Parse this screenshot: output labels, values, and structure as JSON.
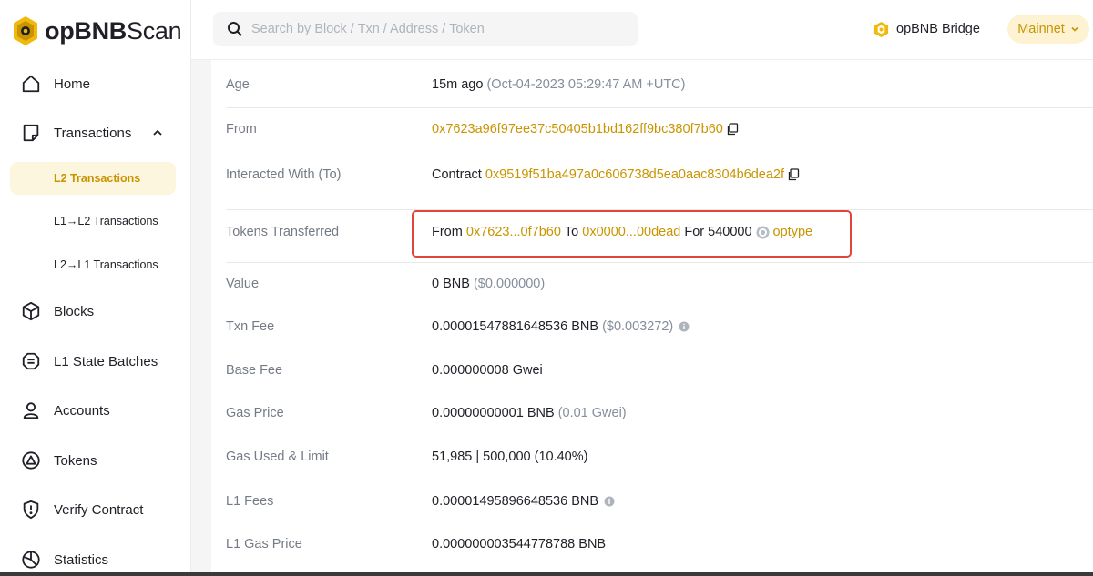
{
  "brand": {
    "name_bold": "opBNB",
    "name_light": "Scan"
  },
  "search": {
    "placeholder": "Search by Block / Txn / Address / Token"
  },
  "header": {
    "bridge_label": "opBNB Bridge",
    "network_label": "Mainnet"
  },
  "sidebar": {
    "items": [
      {
        "label": "Home"
      },
      {
        "label": "Transactions"
      },
      {
        "label": "Blocks"
      },
      {
        "label": "L1 State Batches"
      },
      {
        "label": "Accounts"
      },
      {
        "label": "Tokens"
      },
      {
        "label": "Verify Contract"
      },
      {
        "label": "Statistics"
      }
    ],
    "sub_items": [
      {
        "label": "L2 Transactions",
        "active": true
      },
      {
        "label": "L1→L2 Transactions"
      },
      {
        "label": "L2→L1 Transactions"
      }
    ]
  },
  "details": {
    "age": {
      "label": "Age",
      "value": "15m ago",
      "detail": "(Oct-04-2023 05:29:47 AM +UTC)"
    },
    "from": {
      "label": "From",
      "address": "0x7623a96f97ee37c50405b1bd162ff9bc380f7b60"
    },
    "to": {
      "label": "Interacted With (To)",
      "prefix": "Contract",
      "address": "0x9519f51ba497a0c606738d5ea0aac8304b6dea2f"
    },
    "tokens": {
      "label": "Tokens Transferred",
      "from_word": "From",
      "from_addr": "0x7623...0f7b60",
      "to_word": "To",
      "to_addr": "0x0000...00dead",
      "for_word": "For",
      "amount": "540000",
      "token": "optype"
    },
    "value": {
      "label": "Value",
      "value": "0 BNB",
      "usd": "($0.000000)"
    },
    "txn_fee": {
      "label": "Txn Fee",
      "value": "0.00001547881648536 BNB",
      "usd": "($0.003272)"
    },
    "base_fee": {
      "label": "Base Fee",
      "value": "0.000000008 Gwei"
    },
    "gas_price": {
      "label": "Gas Price",
      "value": "0.00000000001 BNB",
      "detail": "(0.01 Gwei)"
    },
    "gas_used": {
      "label": "Gas Used & Limit",
      "value": "51,985 | 500,000 (10.40%)"
    },
    "l1_fees": {
      "label": "L1 Fees",
      "value": "0.00001495896648536 BNB"
    },
    "l1_gas_price": {
      "label": "L1 Gas Price",
      "value": "0.000000003544778788 BNB"
    }
  },
  "colors": {
    "accent": "#c99400",
    "highlight": "#e0453a",
    "active_bg": "#fdf6de"
  }
}
